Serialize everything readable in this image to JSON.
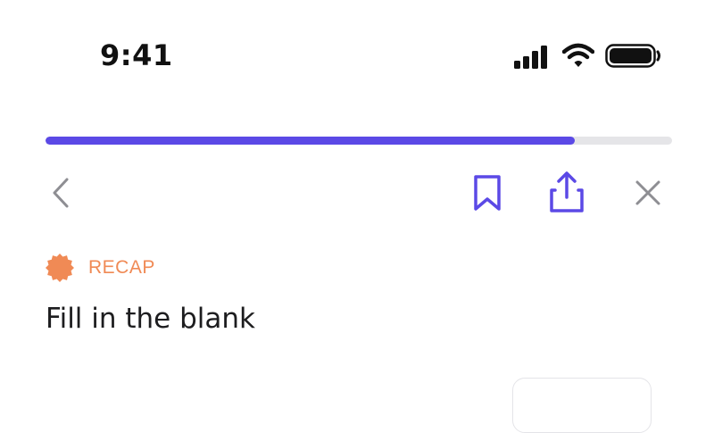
{
  "status_bar": {
    "time": "9:41",
    "icons": [
      "cellular-signal-icon",
      "wifi-icon",
      "battery-icon"
    ]
  },
  "progress": {
    "fraction": 0.845,
    "fill_color": "#5b49e6",
    "track_color": "#e5e5e8"
  },
  "toolbar": {
    "icons": [
      "chevron-left-icon",
      "bookmark-icon",
      "share-icon",
      "close-icon"
    ],
    "accent_color": "#5b49e6",
    "neutral_color": "#8e8e93"
  },
  "section": {
    "label": "RECAP",
    "label_color": "#f08a55",
    "icon": "badge-icon"
  },
  "question": {
    "title": "Fill in the blank"
  }
}
